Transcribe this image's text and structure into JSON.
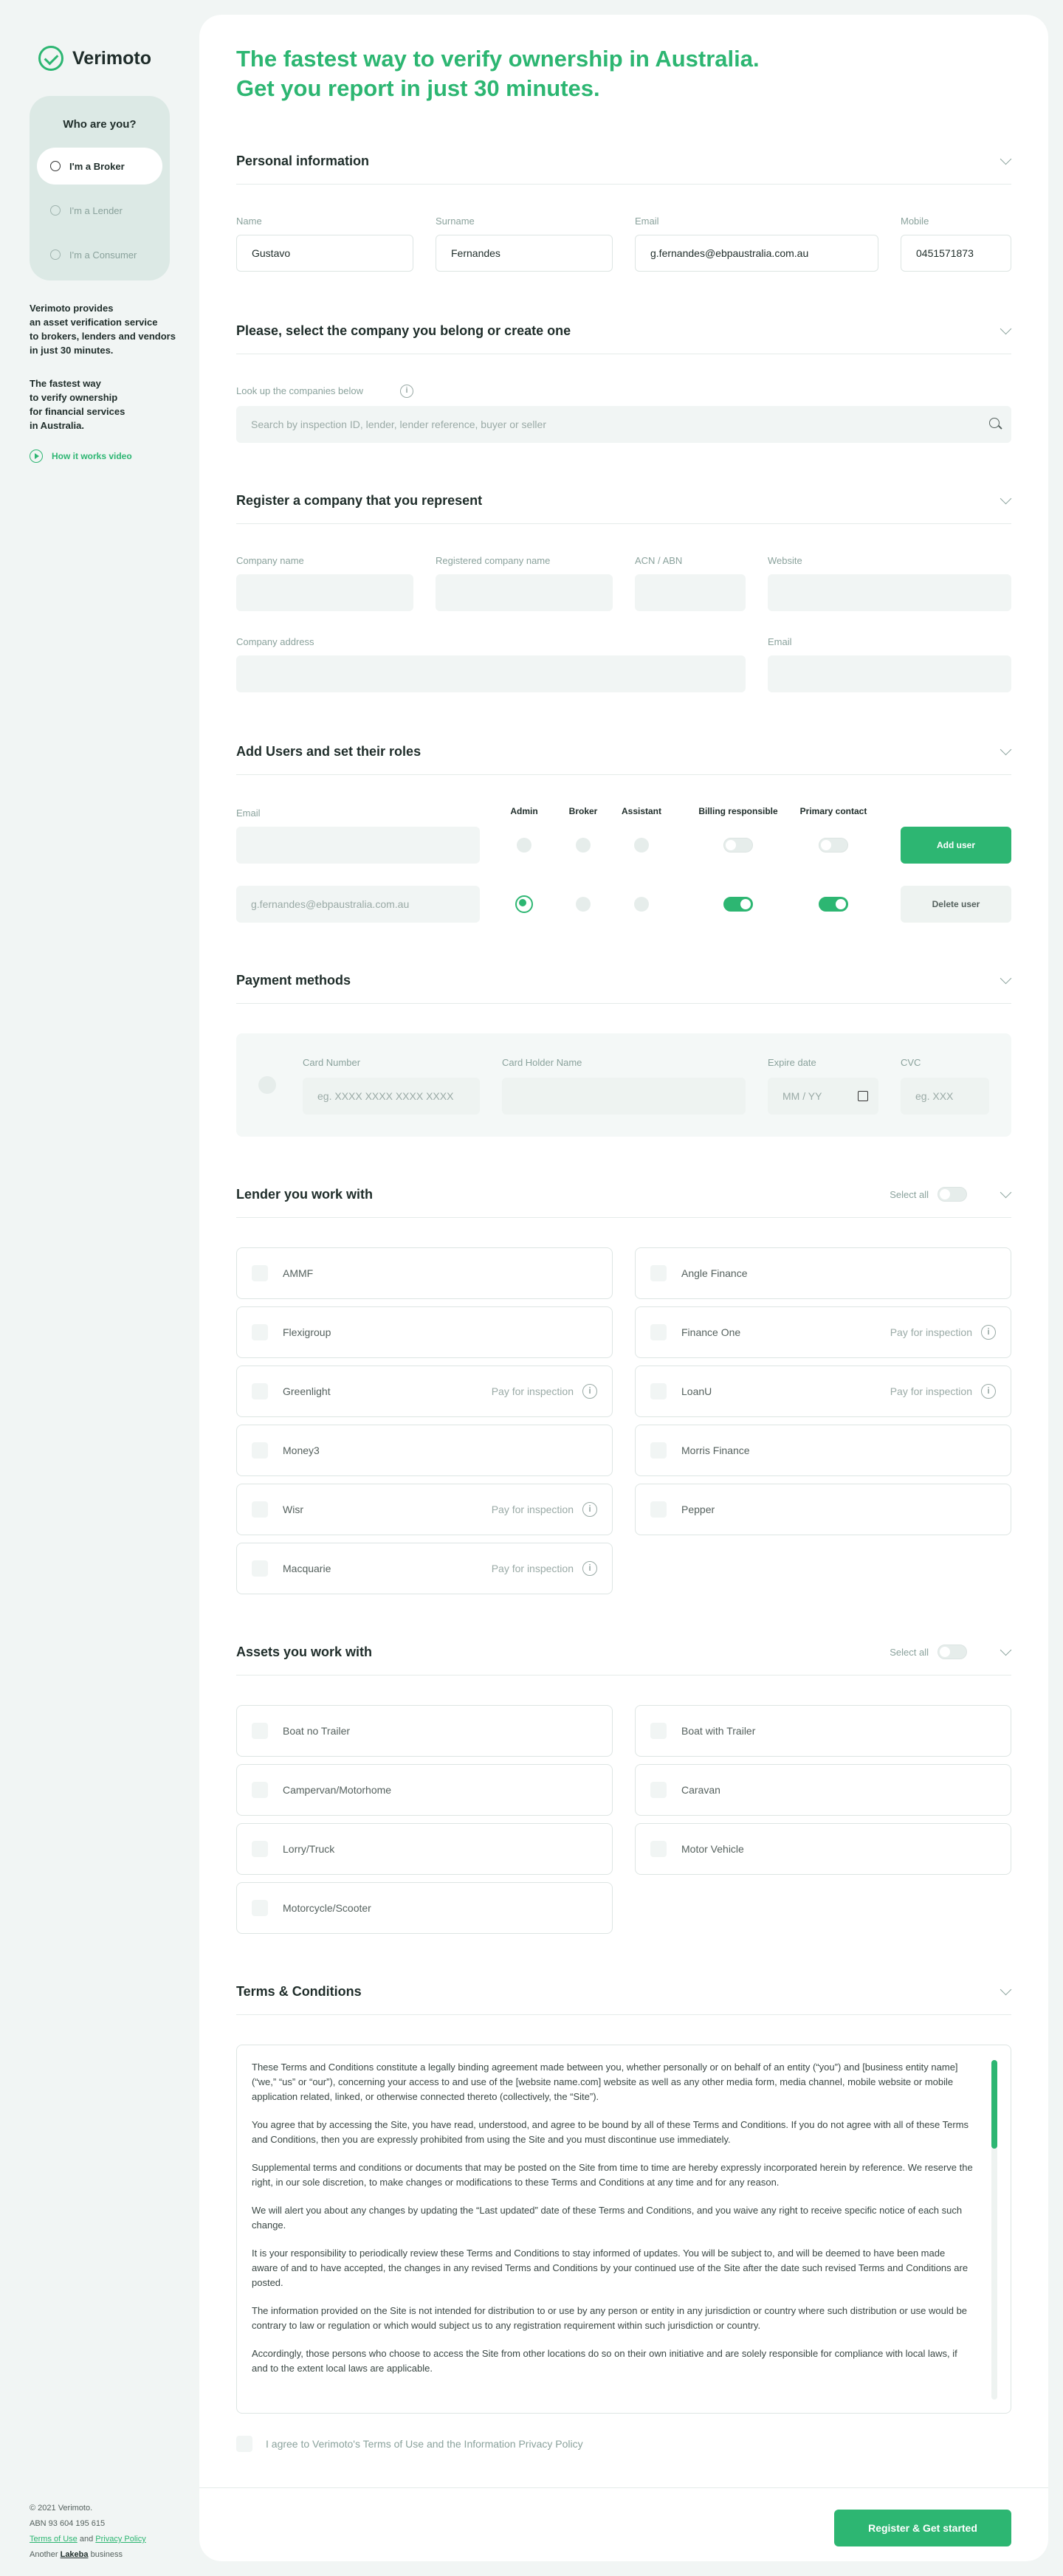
{
  "brand": {
    "name": "Verimoto"
  },
  "sidebar": {
    "who_title": "Who are you?",
    "roles": [
      {
        "label": "I'm a Broker"
      },
      {
        "label": "I'm a Lender"
      },
      {
        "label": "I'm a Consumer"
      }
    ],
    "desc1": [
      "Verimoto provides",
      "an asset verification service",
      "to brokers, lenders and vendors",
      "in just 30 minutes."
    ],
    "desc2": [
      "The fastest way",
      "to verify ownership",
      "for financial services",
      "in Australia."
    ],
    "video_label": "How it works video",
    "footer": {
      "copyright": "© 2021 Verimoto.",
      "abn": "ABN 93 604 195 615",
      "terms": "Terms of Use",
      "and": "and",
      "privacy": "Privacy Policy",
      "another": "Another",
      "lakeba": "Lakeba",
      "business": "business"
    }
  },
  "headline": [
    "The fastest way to verify ownership in Australia.",
    "Get you report in just 30 minutes."
  ],
  "personal": {
    "title": "Personal information",
    "name_label": "Name",
    "name": "Gustavo",
    "surname_label": "Surname",
    "surname": "Fernandes",
    "email_label": "Email",
    "email": "g.fernandes@ebpaustralia.com.au",
    "mobile_label": "Mobile",
    "mobile": "0451571873"
  },
  "company_select": {
    "title": "Please, select the company you belong or create one",
    "lookup_label": "Look up the companies below",
    "search_placeholder": "Search by inspection ID, lender, lender reference, buyer or seller"
  },
  "register": {
    "title": "Register a company that you represent",
    "company_name": "Company name",
    "registered_name": "Registered company name",
    "acn": "ACN / ABN",
    "website": "Website",
    "address": "Company address",
    "email": "Email"
  },
  "users": {
    "title": "Add Users and set their roles",
    "email_label": "Email",
    "cols": [
      "Admin",
      "Broker",
      "Assistant",
      "Billing responsible",
      "Primary contact"
    ],
    "add_label": "Add user",
    "row_email": "g.fernandes@ebpaustralia.com.au",
    "delete_label": "Delete user"
  },
  "payment": {
    "title": "Payment methods",
    "card_number": "Card Number",
    "card_ph": "eg. XXXX XXXX XXXX XXXX",
    "holder": "Card Holder Name",
    "expire": "Expire date",
    "expire_ph": "MM / YY",
    "cvc": "CVC",
    "cvc_ph": "eg. XXX"
  },
  "lenders": {
    "title": "Lender you work with",
    "select_all": "Select all",
    "pay_label": "Pay for inspection",
    "items": [
      {
        "name": "AMMF",
        "pay": false
      },
      {
        "name": "Angle Finance",
        "pay": false
      },
      {
        "name": "Flexigroup",
        "pay": false
      },
      {
        "name": "Finance One",
        "pay": true
      },
      {
        "name": "Greenlight",
        "pay": true
      },
      {
        "name": "LoanU",
        "pay": true
      },
      {
        "name": "Money3",
        "pay": false
      },
      {
        "name": "Morris Finance",
        "pay": false
      },
      {
        "name": "Wisr",
        "pay": true
      },
      {
        "name": "Pepper",
        "pay": false
      },
      {
        "name": "Macquarie",
        "pay": true
      }
    ]
  },
  "assets": {
    "title": "Assets you work with",
    "select_all": "Select all",
    "items": [
      {
        "name": "Boat no Trailer"
      },
      {
        "name": "Boat with Trailer"
      },
      {
        "name": "Campervan/Motorhome"
      },
      {
        "name": "Caravan"
      },
      {
        "name": "Lorry/Truck"
      },
      {
        "name": "Motor Vehicle"
      },
      {
        "name": "Motorcycle/Scooter"
      }
    ]
  },
  "terms": {
    "title": "Terms & Conditions",
    "paragraphs": [
      "These Terms and Conditions constitute a legally binding agreement made between you, whether personally or on behalf of an entity (“you”) and [business entity name] (“we,” “us” or “our”), concerning your access to and use of the [website name.com] website as well as any other media form, media channel, mobile website or mobile application related, linked, or otherwise connected thereto (collectively, the “Site”).",
      "You agree that by accessing the Site, you have read, understood, and agree to be bound by all of these Terms and Conditions. If you do not agree with all of these Terms and Conditions, then you are expressly prohibited from using the Site and you must discontinue use immediately.",
      "Supplemental terms and conditions or documents that may be posted on the Site from time to time are hereby expressly incorporated herein by reference. We reserve the right, in our sole discretion, to make changes or modifications to these Terms and Conditions at any time and for any reason.",
      "We will alert you about any changes by updating the “Last updated” date of these Terms and Conditions, and you waive any right to receive specific notice of each such change.",
      "It is your responsibility to periodically review these Terms and Conditions to stay informed of updates. You will be subject to, and will be deemed to have been made aware of and to have accepted, the changes in any revised Terms and Conditions by your continued use of the Site after the date such revised Terms and Conditions are posted.",
      "The information provided on the Site is not intended for distribution to or use by any person or entity in any jurisdiction or country where such distribution or use would be contrary to law or regulation or which would subject us to any registration requirement within such jurisdiction or country.",
      "Accordingly, those persons who choose to access the Site from other locations do so on their own initiative and are solely responsible for compliance with local laws, if and to the extent local laws are applicable."
    ],
    "agree": "I agree to Verimoto's Terms of Use and the Information Privacy Policy"
  },
  "submit": "Register & Get started"
}
